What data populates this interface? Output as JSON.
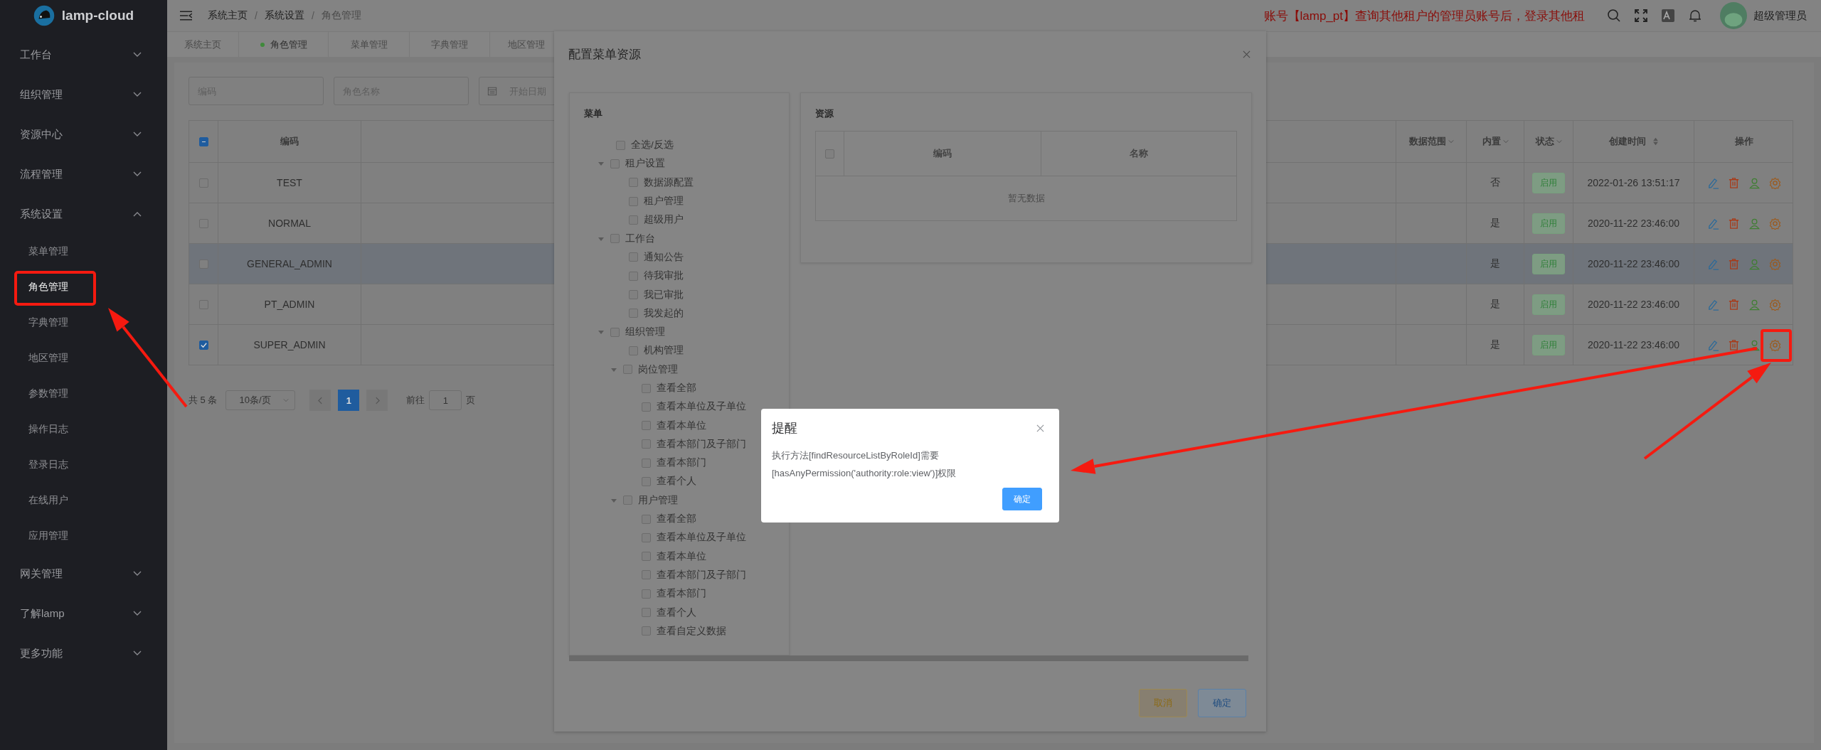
{
  "sidebar": {
    "logo": "lamp-cloud",
    "items": [
      {
        "label": "工作台",
        "expanded": false
      },
      {
        "label": "组织管理",
        "expanded": false
      },
      {
        "label": "资源中心",
        "expanded": false
      },
      {
        "label": "流程管理",
        "expanded": false
      },
      {
        "label": "系统设置",
        "expanded": true,
        "children": [
          {
            "label": "菜单管理",
            "selected": false
          },
          {
            "label": "角色管理",
            "selected": true
          },
          {
            "label": "字典管理",
            "selected": false
          },
          {
            "label": "地区管理",
            "selected": false
          },
          {
            "label": "参数管理",
            "selected": false
          },
          {
            "label": "操作日志",
            "selected": false
          },
          {
            "label": "登录日志",
            "selected": false
          },
          {
            "label": "在线用户",
            "selected": false
          },
          {
            "label": "应用管理",
            "selected": false
          }
        ]
      },
      {
        "label": "网关管理",
        "expanded": false
      },
      {
        "label": "了解lamp",
        "expanded": false
      },
      {
        "label": "更多功能",
        "expanded": false
      }
    ]
  },
  "header": {
    "breadcrumb": [
      "系统主页",
      "系统设置",
      "角色管理"
    ],
    "breadcrumb_separators": [
      "/",
      "/"
    ],
    "notice": "账号【lamp_pt】查询其他租户的管理员账号后，登录其他租",
    "user": "超级管理员"
  },
  "tabs": [
    {
      "label": "系统主页",
      "selected": false
    },
    {
      "label": "角色管理",
      "selected": true
    },
    {
      "label": "菜单管理",
      "selected": false
    },
    {
      "label": "字典管理",
      "selected": false
    },
    {
      "label": "地区管理",
      "selected": false
    }
  ],
  "filters": [
    {
      "placeholder": "编码",
      "kind": "text"
    },
    {
      "placeholder": "角色名称",
      "kind": "text"
    },
    {
      "placeholder": "开始日期",
      "kind": "date"
    }
  ],
  "table": {
    "header_checkbox": {
      "indeterminate": true
    },
    "columns": [
      {
        "label": "编码",
        "kind": "plain"
      },
      {
        "label": "数据范围",
        "kind": "filter"
      },
      {
        "label": "内置",
        "kind": "filter"
      },
      {
        "label": "状态",
        "kind": "filter"
      },
      {
        "label": "创建时间",
        "kind": "sort"
      },
      {
        "label": "操作",
        "kind": "plain"
      }
    ],
    "rows": [
      {
        "checked": false,
        "highlighted": false,
        "code": "TEST",
        "builtin": "否",
        "status": "启用",
        "created": "2022-01-26 13:51:17"
      },
      {
        "checked": false,
        "highlighted": false,
        "code": "NORMAL",
        "builtin": "是",
        "status": "启用",
        "created": "2020-11-22 23:46:00"
      },
      {
        "checked": false,
        "highlighted": true,
        "code": "GENERAL_ADMIN",
        "builtin": "是",
        "status": "启用",
        "created": "2020-11-22 23:46:00"
      },
      {
        "checked": false,
        "highlighted": false,
        "code": "PT_ADMIN",
        "builtin": "是",
        "status": "启用",
        "created": "2020-11-22 23:46:00"
      },
      {
        "checked": true,
        "highlighted": false,
        "code": "SUPER_ADMIN",
        "builtin": "是",
        "status": "启用",
        "created": "2020-11-22 23:46:00"
      }
    ]
  },
  "pagination": {
    "total": "共 5 条",
    "page_size": "10条/页",
    "pages": [
      {
        "label": "1",
        "selected": true
      }
    ],
    "goto_label": "前往",
    "goto_value": "1",
    "goto_suffix": "页"
  },
  "modal": {
    "title": "配置菜单资源",
    "menu_panel": {
      "title": "菜单",
      "tree": [
        {
          "label": "全选/反选",
          "checked": false
        },
        {
          "label": "租户设置",
          "checked": false,
          "expanded": true,
          "children": [
            {
              "label": "数据源配置",
              "checked": false
            },
            {
              "label": "租户管理",
              "checked": false
            },
            {
              "label": "超级用户",
              "checked": false
            }
          ]
        },
        {
          "label": "工作台",
          "checked": false,
          "expanded": true,
          "children": [
            {
              "label": "通知公告",
              "checked": false
            },
            {
              "label": "待我审批",
              "checked": false
            },
            {
              "label": "我已审批",
              "checked": false
            },
            {
              "label": "我发起的",
              "checked": false
            }
          ]
        },
        {
          "label": "组织管理",
          "checked": false,
          "expanded": true,
          "children": [
            {
              "label": "机构管理",
              "checked": false
            },
            {
              "label": "岗位管理",
              "checked": false,
              "expanded": true,
              "children": [
                {
                  "label": "查看全部",
                  "checked": false
                },
                {
                  "label": "查看本单位及子单位",
                  "checked": false
                },
                {
                  "label": "查看本单位",
                  "checked": false
                },
                {
                  "label": "查看本部门及子部门",
                  "checked": false
                },
                {
                  "label": "查看本部门",
                  "checked": false
                },
                {
                  "label": "查看个人",
                  "checked": false
                }
              ]
            },
            {
              "label": "用户管理",
              "checked": false,
              "expanded": true,
              "children": [
                {
                  "label": "查看全部",
                  "checked": false
                },
                {
                  "label": "查看本单位及子单位",
                  "checked": false
                },
                {
                  "label": "查看本单位",
                  "checked": false
                },
                {
                  "label": "查看本部门及子部门",
                  "checked": false
                },
                {
                  "label": "查看本部门",
                  "checked": false
                },
                {
                  "label": "查看个人",
                  "checked": false
                },
                {
                  "label": "查看自定义数据",
                  "checked": false
                }
              ]
            }
          ]
        }
      ]
    },
    "resource_panel": {
      "title": "资源",
      "header_checkbox": {
        "checked": false
      },
      "columns": [
        "编码",
        "名称"
      ],
      "empty": "暂无数据"
    },
    "buttons": [
      {
        "label": "取消",
        "kind": "warning"
      },
      {
        "label": "确定",
        "kind": "primary"
      }
    ]
  },
  "alert": {
    "title": "提醒",
    "message_lines": [
      "执行方法[findResourceListByRoleId]需要",
      "[hasAnyPermission('authority:role:view')]权限"
    ],
    "button": "确定"
  }
}
